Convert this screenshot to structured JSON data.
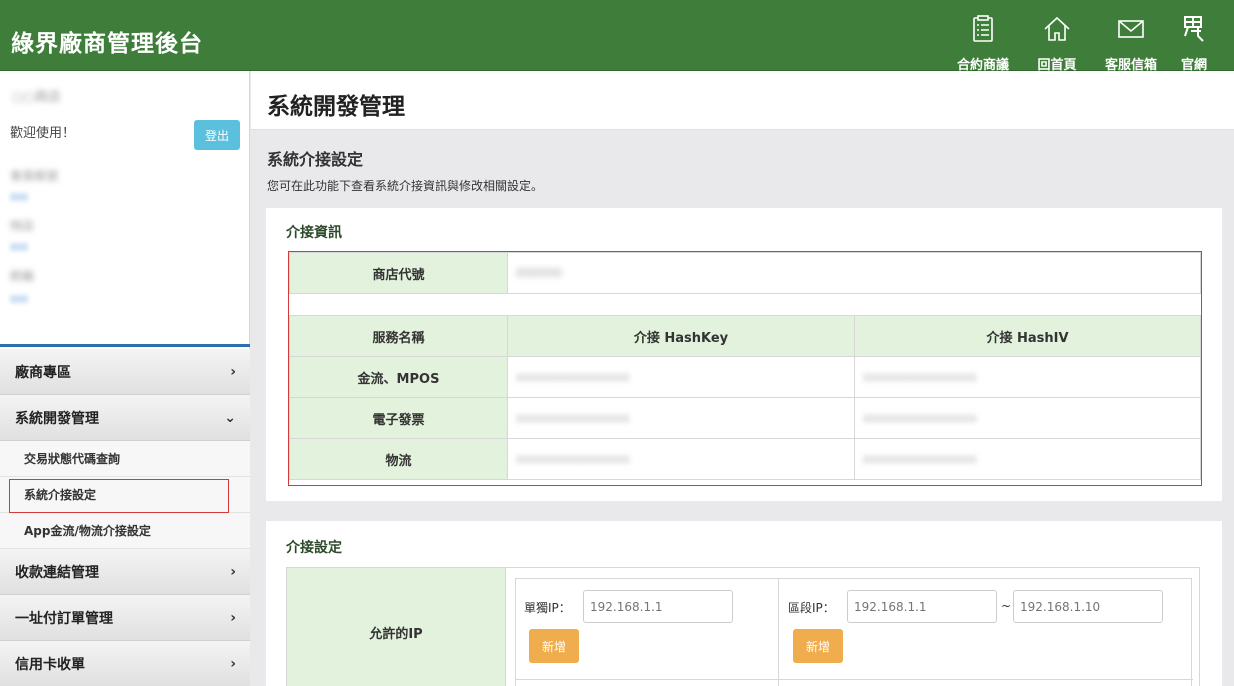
{
  "header": {
    "brand": "綠界廠商管理後台",
    "nav": [
      {
        "label": "合約商議",
        "icon": "clipboard-icon"
      },
      {
        "label": "回首頁",
        "icon": "home-icon"
      },
      {
        "label": "客服信箱",
        "icon": "mail-icon"
      },
      {
        "label": "官網",
        "icon": "logo-icon"
      }
    ]
  },
  "sidebar": {
    "user_name": "○○商店",
    "welcome": "歡迎使用！",
    "logout": "登出",
    "accounts": [
      "會員帳號",
      "特店",
      "統編"
    ],
    "menu": [
      {
        "label": "廠商專區",
        "chevron": "›"
      },
      {
        "label": "系統開發管理",
        "chevron": "⌄"
      }
    ],
    "submenu": [
      {
        "label": "交易狀態代碼查詢"
      },
      {
        "label": "系統介接設定"
      },
      {
        "label": "App金流/物流介接設定"
      }
    ],
    "menu_after": [
      {
        "label": "收款連結管理",
        "chevron": "›"
      },
      {
        "label": "一址付訂單管理",
        "chevron": "›"
      },
      {
        "label": "信用卡收單",
        "chevron": "›"
      }
    ]
  },
  "main": {
    "page_title": "系統開發管理",
    "section_title": "系統介接設定",
    "section_desc": "您可在此功能下查看系統介接資訊與修改相關設定。",
    "info_panel": {
      "title": "介接資訊",
      "store_id_label": "商店代號",
      "store_id_value": "000000",
      "columns": [
        "服務名稱",
        "介接 HashKey",
        "介接 HashIV"
      ],
      "rows": [
        {
          "service": "金流、MPOS",
          "key": "xxxxxxxxxxxxxxxx",
          "iv": "xxxxxxxxxxxxxxxx"
        },
        {
          "service": "電子發票",
          "key": "xxxxxxxxxxxxxxxx",
          "iv": "xxxxxxxxxxxxxxxx"
        },
        {
          "service": "物流",
          "key": "xxxxxxxxxxxxxxxx",
          "iv": "xxxxxxxxxxxxxxxx"
        }
      ]
    },
    "settings_panel": {
      "title": "介接設定",
      "allowed_ip_label": "允許的IP",
      "single_ip_label": "單獨IP：",
      "single_ip_placeholder": "192.168.1.1",
      "range_ip_label": "區段IP：",
      "range_start_placeholder": "192.168.1.1",
      "range_sep": "~",
      "range_end_placeholder": "192.168.1.10",
      "add_label": "新增"
    }
  }
}
